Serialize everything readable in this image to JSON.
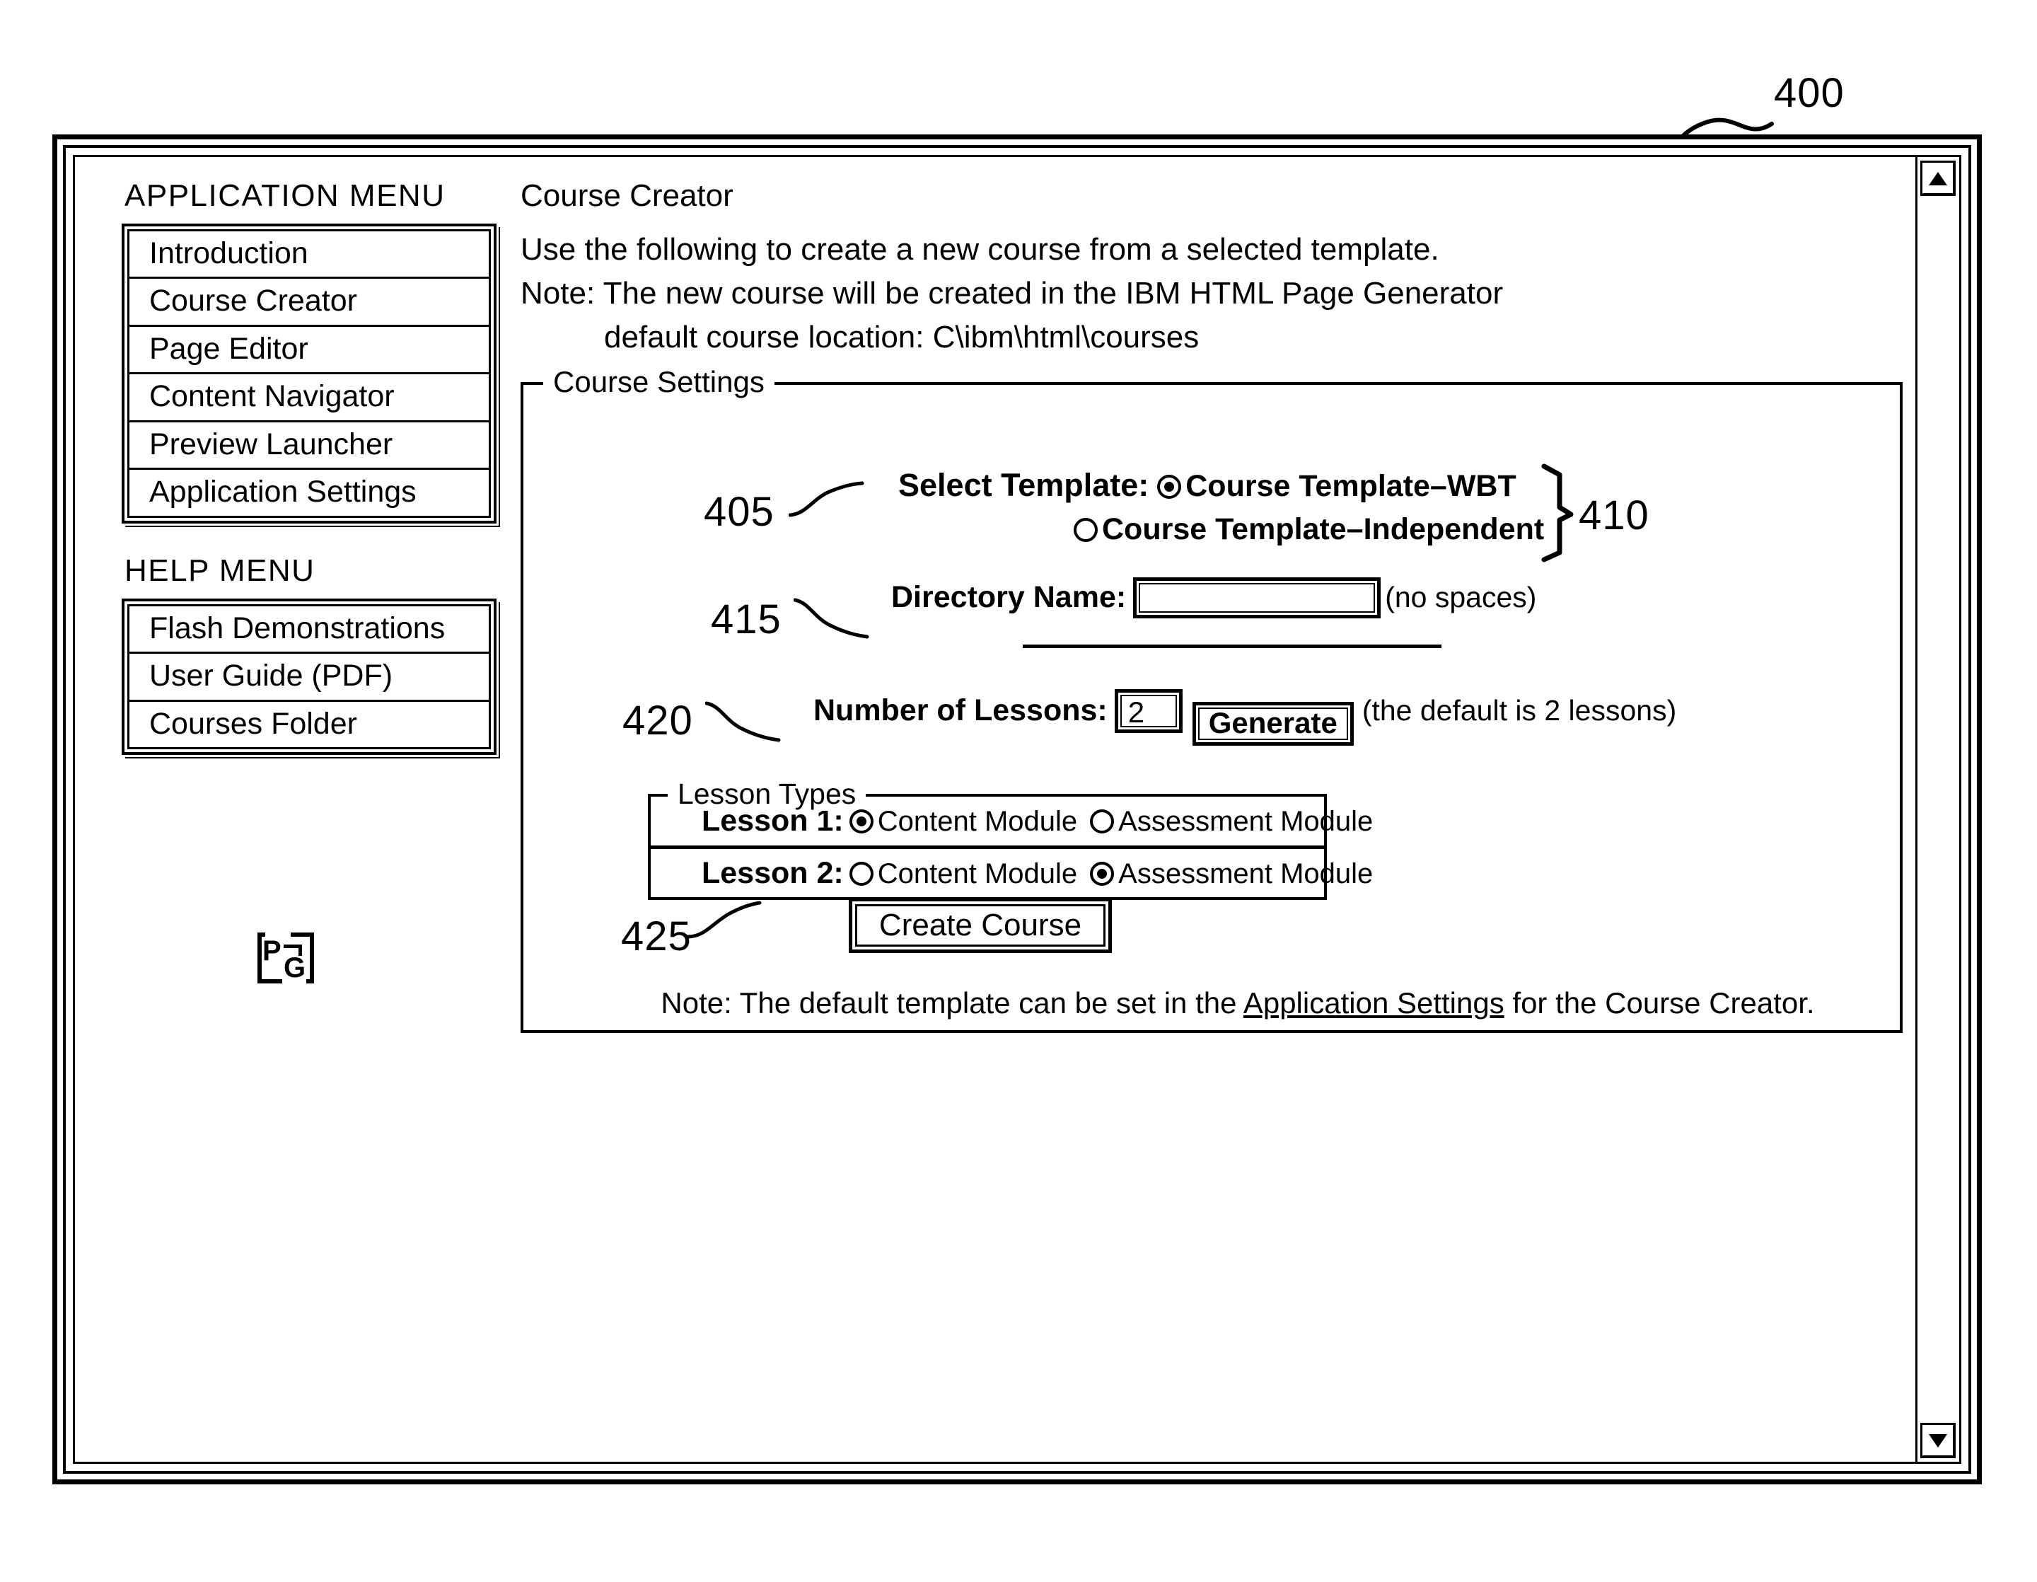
{
  "figure": {
    "main_ref": "400",
    "refs": {
      "select_template": "405",
      "template_group": "410",
      "directory_name": "415",
      "number_of_lessons": "420",
      "lesson_types": "425"
    }
  },
  "window": {
    "scroll_up_icon": "triangle-up-icon",
    "scroll_down_icon": "triangle-down-icon"
  },
  "sidebar": {
    "application_menu_heading": "APPLICATION MENU",
    "application_menu_items": [
      {
        "label": "Introduction"
      },
      {
        "label": "Course Creator"
      },
      {
        "label": "Page Editor"
      },
      {
        "label": "Content Navigator"
      },
      {
        "label": "Preview Launcher"
      },
      {
        "label": "Application Settings"
      }
    ],
    "help_menu_heading": "HELP MENU",
    "help_menu_items": [
      {
        "label": "Flash Demonstrations"
      },
      {
        "label": "User Guide (PDF)"
      },
      {
        "label": "Courses Folder"
      }
    ],
    "logo": {
      "name": "pg-logo",
      "letters": "PG"
    }
  },
  "main": {
    "title": "Course Creator",
    "intro": "Use the following to create a new course from a selected template.",
    "note_line1": "Note: The new course will be created in the IBM HTML Page Generator",
    "note_line2": "default course location: C\\ibm\\html\\courses",
    "course_settings": {
      "legend": "Course Settings",
      "select_template": {
        "label": "Select Template:",
        "options": [
          {
            "label": "Course Template–WBT",
            "selected": true
          },
          {
            "label": "Course Template–Independent",
            "selected": false
          }
        ]
      },
      "directory_name": {
        "label": "Directory Name:",
        "value": "",
        "placeholder": "",
        "hint": "(no spaces)"
      },
      "number_of_lessons": {
        "label": "Number of Lessons:",
        "value": "2",
        "generate_label": "Generate",
        "hint": "(the default is 2 lessons)"
      },
      "lesson_types": {
        "legend": "Lesson Types",
        "rows": [
          {
            "label": "Lesson 1:",
            "options": [
              {
                "label": "Content Module",
                "selected": true
              },
              {
                "label": "Assessment Module",
                "selected": false
              }
            ]
          },
          {
            "label": "Lesson 2:",
            "options": [
              {
                "label": "Content Module",
                "selected": false
              },
              {
                "label": "Assessment Module",
                "selected": true
              }
            ]
          }
        ]
      },
      "create_button_label": "Create Course",
      "footer_note": {
        "prefix": "Note: The default template can be set in the ",
        "link": "Application Settings",
        "suffix": " for the Course Creator."
      }
    }
  }
}
